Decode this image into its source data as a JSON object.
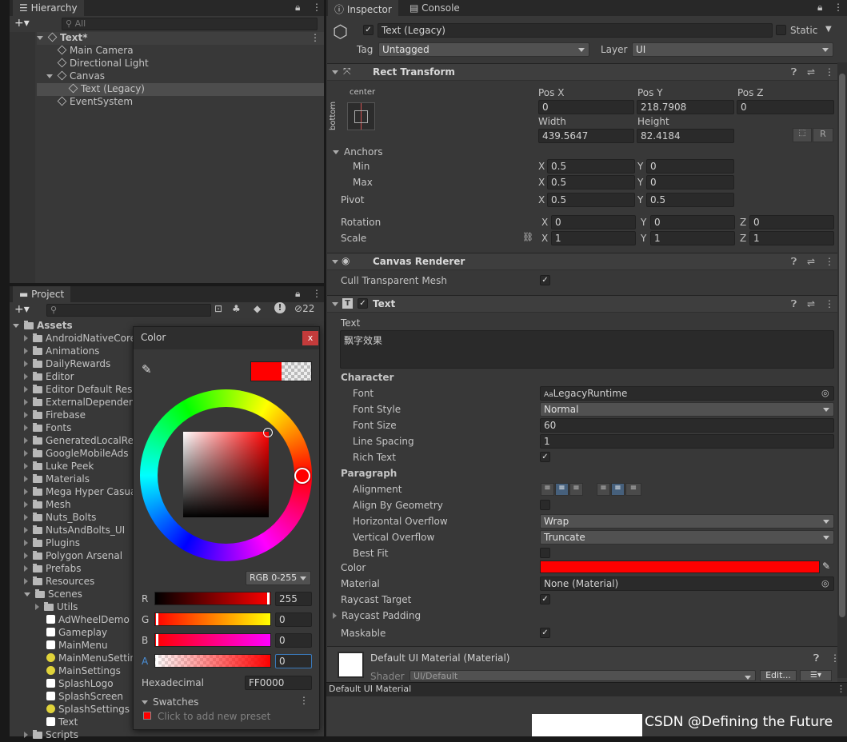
{
  "hierarchy": {
    "tab": "Hierarchy",
    "search_placeholder": "All",
    "scene": "Text*",
    "items": [
      "Main Camera",
      "Directional Light",
      "Canvas",
      "Text (Legacy)",
      "EventSystem"
    ]
  },
  "project": {
    "tab": "Project",
    "count": "22",
    "root": "Assets",
    "folders": [
      "AndroidNativeCore",
      "Animations",
      "DailyRewards",
      "Editor",
      "Editor Default Reso",
      "ExternalDependenc",
      "Firebase",
      "Fonts",
      "GeneratedLocalRe",
      "GoogleMobileAds",
      "Luke Peek",
      "Materials",
      "Mega Hyper Casua",
      "Mesh",
      "Nuts_Bolts",
      "NutsAndBolts_UI",
      "Plugins",
      "Polygon Arsenal",
      "Prefabs",
      "Resources",
      "Scenes"
    ],
    "scenes_children": [
      "Utils",
      "AdWheelDemo",
      "Gameplay",
      "MainMenu",
      "MainMenuSettin",
      "MainSettings",
      "SplashLogo",
      "SplashScreen",
      "SplashSettings",
      "Text"
    ],
    "last": "Scripts"
  },
  "color_picker": {
    "title": "Color",
    "close": "x",
    "mode": "RGB 0-255",
    "r_label": "R",
    "r": "255",
    "g_label": "G",
    "g": "0",
    "b_label": "B",
    "b": "0",
    "a_label": "A",
    "a": "0",
    "hex_label": "Hexadecimal",
    "hex": "FF0000",
    "swatches": "Swatches",
    "add_preset": "Click to add new preset",
    "color": "#ff0000"
  },
  "inspector": {
    "tab": "Inspector",
    "console_tab": "Console",
    "object_name": "Text (Legacy)",
    "static_label": "Static",
    "tag_label": "Tag",
    "tag": "Untagged",
    "layer_label": "Layer",
    "layer": "UI",
    "rect_transform": {
      "title": "Rect Transform",
      "anchor_h": "center",
      "anchor_v": "bottom",
      "pos_x_label": "Pos X",
      "pos_x": "0",
      "pos_y_label": "Pos Y",
      "pos_y": "218.7908",
      "pos_z_label": "Pos Z",
      "pos_z": "0",
      "width_label": "Width",
      "width": "439.5647",
      "height_label": "Height",
      "height": "82.4184",
      "r_button": "R",
      "anchors": "Anchors",
      "min": "Min",
      "max": "Max",
      "pivot": "Pivot",
      "min_x": "0.5",
      "min_y": "0",
      "max_x": "0.5",
      "max_y": "0",
      "pivot_x": "0.5",
      "pivot_y": "0.5",
      "rotation": "Rotation",
      "rot_x": "0",
      "rot_y": "0",
      "rot_z": "0",
      "scale": "Scale",
      "scale_x": "1",
      "scale_y": "1",
      "scale_z": "1",
      "x": "X",
      "y": "Y",
      "z": "Z"
    },
    "canvas_renderer": {
      "title": "Canvas Renderer",
      "cull": "Cull Transparent Mesh"
    },
    "text": {
      "title": "Text",
      "text_label": "Text",
      "text_value": "飘字效果",
      "character": "Character",
      "font_label": "Font",
      "font": "LegacyRuntime",
      "font_style_label": "Font Style",
      "font_style": "Normal",
      "font_size_label": "Font Size",
      "font_size": "60",
      "line_spacing_label": "Line Spacing",
      "line_spacing": "1",
      "rich_text_label": "Rich Text",
      "paragraph": "Paragraph",
      "alignment_label": "Alignment",
      "align_geo_label": "Align By Geometry",
      "h_overflow_label": "Horizontal Overflow",
      "h_overflow": "Wrap",
      "v_overflow_label": "Vertical Overflow",
      "v_overflow": "Truncate",
      "best_fit_label": "Best Fit",
      "color_label": "Color",
      "material_label": "Material",
      "material": "None (Material)",
      "raycast_target_label": "Raycast Target",
      "raycast_padding_label": "Raycast Padding",
      "maskable_label": "Maskable"
    },
    "material_section": {
      "title": "Default UI Material (Material)",
      "shader_label": "Shader",
      "shader": "UI/Default",
      "edit": "Edit..."
    },
    "preview_bar": "Default UI Material"
  },
  "watermark": "CSDN @Defining the Future"
}
